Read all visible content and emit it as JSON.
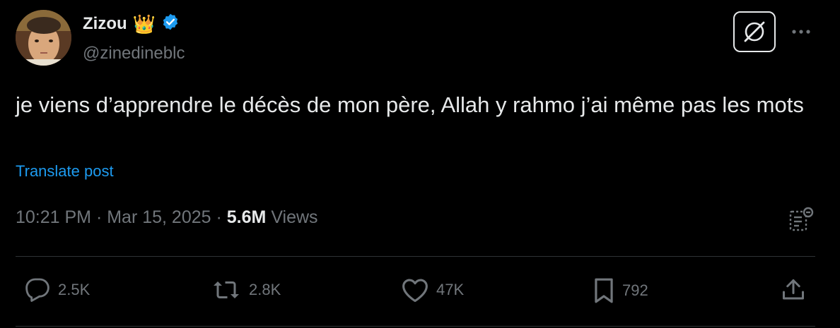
{
  "author": {
    "display_name": "Zizou",
    "crown_emoji": "👑",
    "handle": "@zinedineblc",
    "verified_color": "#1d9bf0"
  },
  "tweet": {
    "text": "je viens d’apprendre le décès de mon père, Allah y rahmo j’ai même pas les mots",
    "translate_label": "Translate post",
    "time": "10:21 PM",
    "separator1": " · ",
    "date": "Mar 15, 2025",
    "separator2": " · ",
    "views_count": "5.6M",
    "views_label": " Views"
  },
  "actions": {
    "replies": "2.5K",
    "reposts": "2.8K",
    "likes": "47K",
    "bookmarks": "792"
  },
  "icons": {
    "grok": "grok-icon",
    "more": "more-icon",
    "analytics": "analytics-icon",
    "reply": "reply-icon",
    "repost": "repost-icon",
    "like": "heart-icon",
    "bookmark": "bookmark-icon",
    "share": "share-icon"
  }
}
